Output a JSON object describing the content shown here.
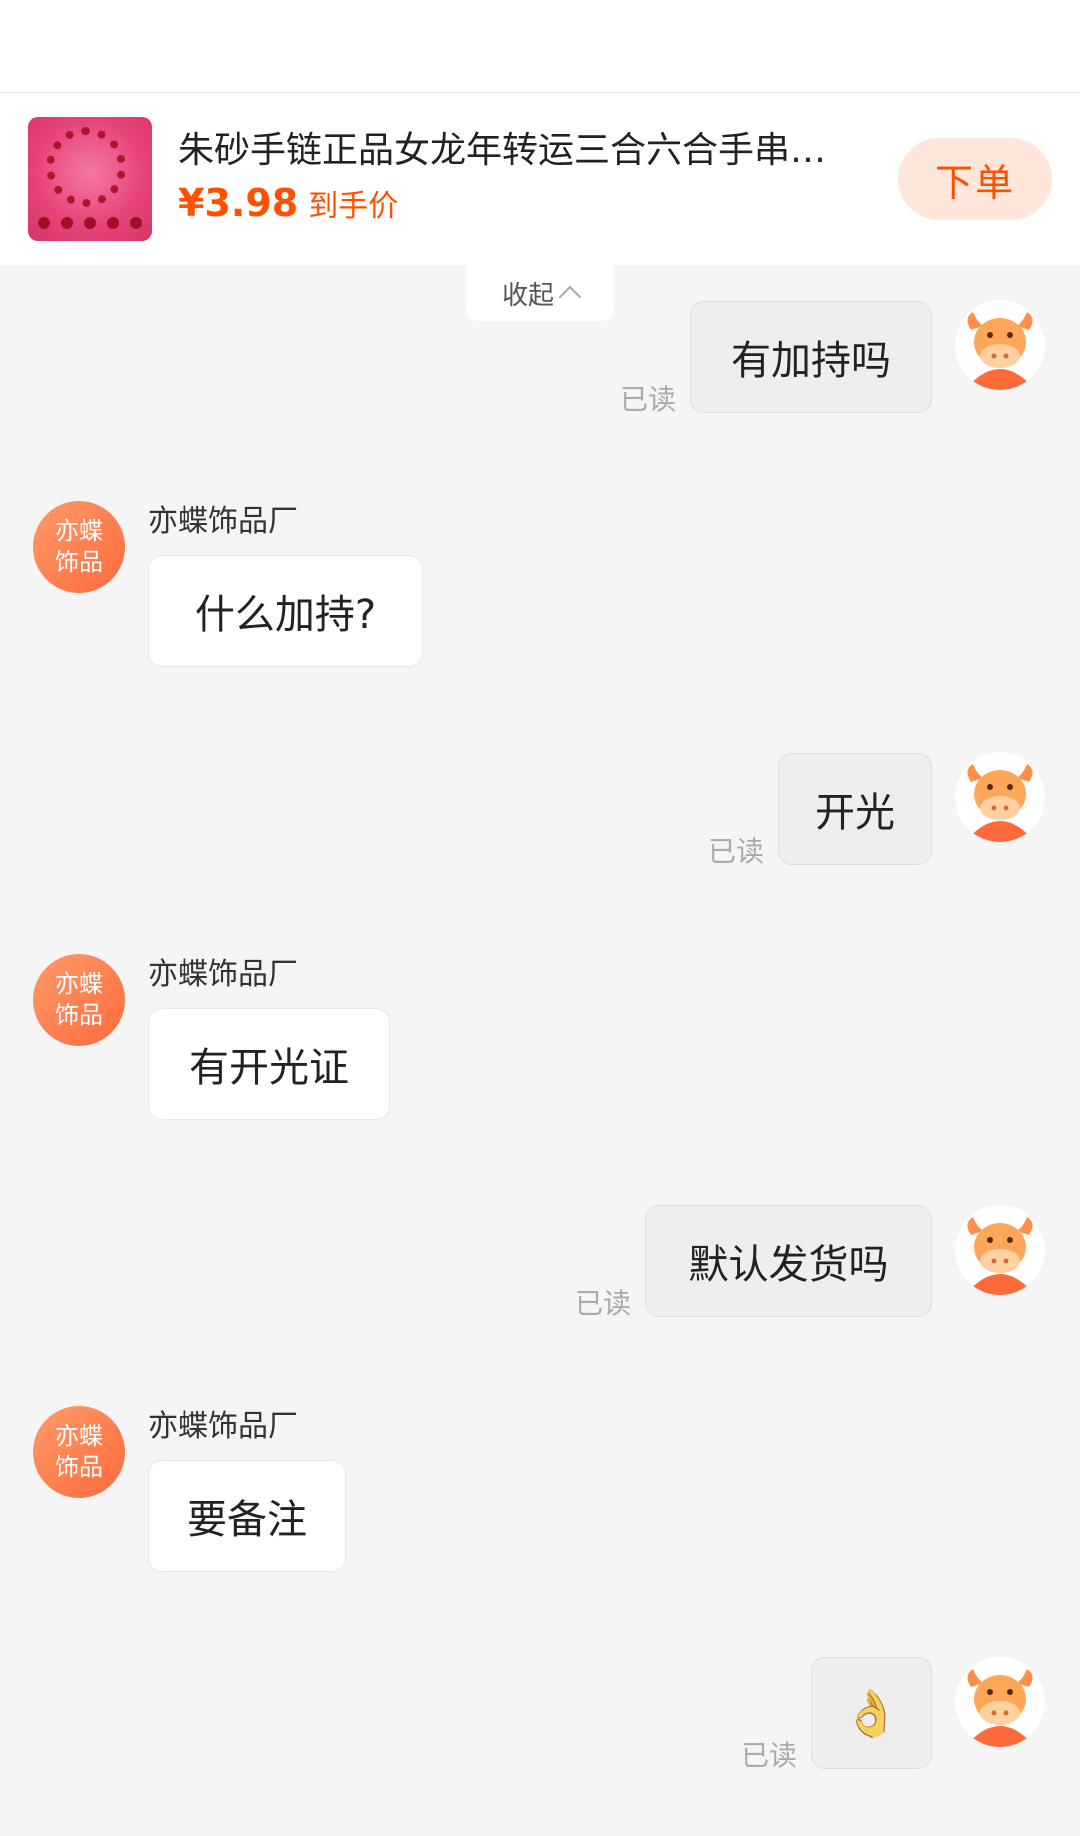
{
  "product": {
    "title": "朱砂手链正品女龙年转运三合六合手串…",
    "price": "¥3.98",
    "price_suffix": "到手价",
    "order_label": "下单",
    "collapse_label": "收起"
  },
  "shop": {
    "name": "亦蝶饰品厂",
    "avatar_text": "亦蝶饰品"
  },
  "read_status": "已读",
  "messages": [
    {
      "from": "me",
      "text": "有加持吗"
    },
    {
      "from": "shop",
      "text": "什么加持?"
    },
    {
      "from": "me",
      "text": "开光"
    },
    {
      "from": "shop",
      "text": "有开光证"
    },
    {
      "from": "me",
      "text": "默认发货吗"
    },
    {
      "from": "shop",
      "text": "要备注"
    },
    {
      "from": "me",
      "text": "👌",
      "type": "emoji"
    }
  ],
  "colors": {
    "accent": "#ff5000",
    "order_button_bg": "#ffe6da",
    "background": "#f5f5f5"
  },
  "icons": {
    "user_avatar": "bull-avatar-icon",
    "collapse": "chevron-up-icon"
  }
}
